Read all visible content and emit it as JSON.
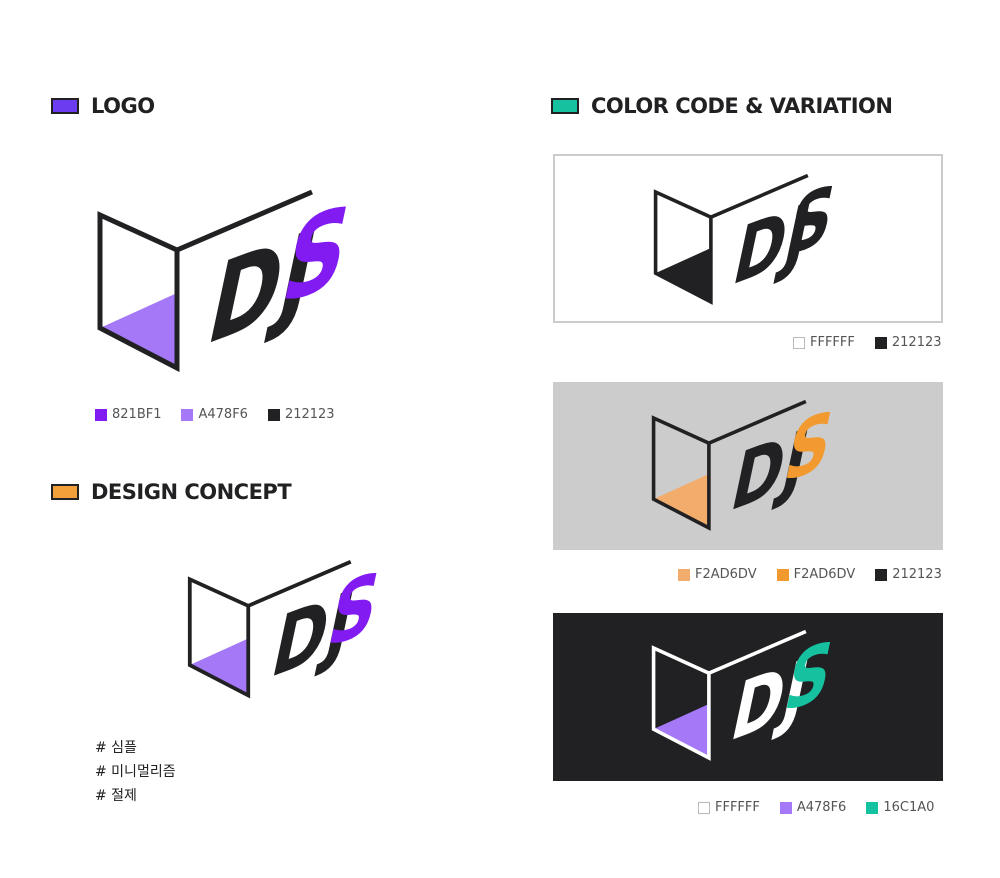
{
  "sections": {
    "logo": {
      "title": "LOGO",
      "chip_color": "#6B3CF0"
    },
    "design_concept": {
      "title": "DESIGN CONCEPT",
      "chip_color": "#F2A03A"
    },
    "color_code": {
      "title": "COLOR CODE & VARIATION",
      "chip_color": "#16C1A0"
    }
  },
  "logo": {
    "wordmark": "DJS",
    "swatches": [
      {
        "label": "821BF1",
        "color": "#821BF1"
      },
      {
        "label": "A478F6",
        "color": "#A478F6"
      },
      {
        "label": "212123",
        "color": "#212123"
      }
    ]
  },
  "design_concept": {
    "tags": [
      "# 심플",
      "# 미니멀리즘",
      "# 절제"
    ]
  },
  "variations": [
    {
      "background": "#FFFFFF",
      "outline": "#212123",
      "fill": "#212123",
      "letters": "#212123",
      "s_letter": "#212123",
      "swatches": [
        {
          "label": "FFFFFF",
          "color": "#FFFFFF",
          "outlined": true
        },
        {
          "label": "212123",
          "color": "#212123"
        }
      ]
    },
    {
      "background": "#CCCCCC",
      "outline": "#212123",
      "fill": "#F2AD6D",
      "letters": "#212123",
      "s_letter": "#F29A30",
      "swatches": [
        {
          "label": "F2AD6DV",
          "color": "#F2AD6D"
        },
        {
          "label": "F2AD6DV",
          "color": "#F29A30"
        },
        {
          "label": "212123",
          "color": "#212123"
        }
      ]
    },
    {
      "background": "#212123",
      "outline": "#FFFFFF",
      "fill": "#A478F6",
      "letters": "#FFFFFF",
      "s_letter": "#16C1A0",
      "swatches": [
        {
          "label": "FFFFFF",
          "color": "#FFFFFF",
          "outlined": true
        },
        {
          "label": "A478F6",
          "color": "#A478F6"
        },
        {
          "label": "16C1A0",
          "color": "#16C1A0"
        }
      ]
    }
  ]
}
